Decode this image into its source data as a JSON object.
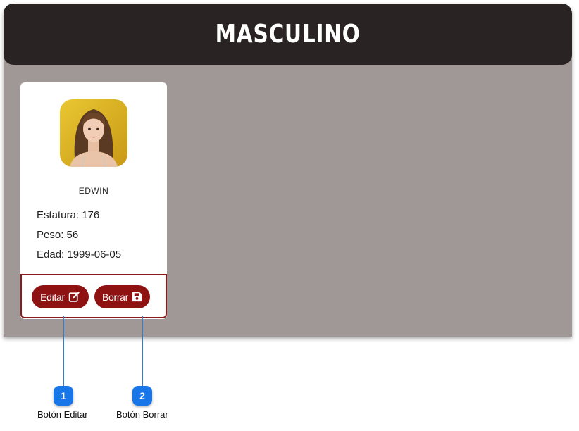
{
  "header": {
    "title": "MASCULINO"
  },
  "card": {
    "name": "EDWIN",
    "estatura": "Estatura: 176",
    "peso": "Peso: 56",
    "edad": "Edad: 1999-06-05",
    "avatar_icon": "person-photo"
  },
  "actions": {
    "edit_label": "Editar",
    "edit_icon": "edit-icon",
    "delete_label": "Borrar",
    "delete_icon": "save-icon"
  },
  "callouts": [
    {
      "number": "1",
      "label": "Botón Editar"
    },
    {
      "number": "2",
      "label": "Botón Borrar"
    }
  ],
  "colors": {
    "header_bg": "#2a2323",
    "panel_bg": "#a09797",
    "button_bg": "#8e1212",
    "badge_bg": "#1976e8"
  }
}
